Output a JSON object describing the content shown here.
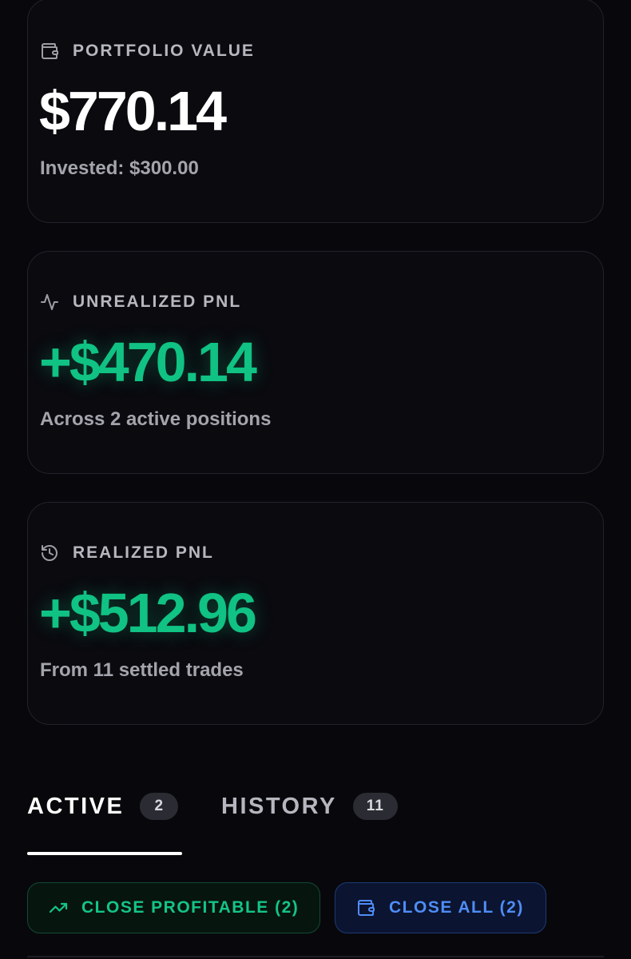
{
  "portfolio": {
    "label": "PORTFOLIO VALUE",
    "icon": "wallet-icon",
    "value": "$770.14",
    "subtext": "Invested: $300.00"
  },
  "unrealized": {
    "label": "UNREALIZED PNL",
    "icon": "activity-icon",
    "value": "+$470.14",
    "subtext": "Across 2 active positions",
    "value_color": "#10c283"
  },
  "realized": {
    "label": "REALIZED PNL",
    "icon": "history-icon",
    "value": "+$512.96",
    "subtext": "From 11 settled trades",
    "value_color": "#10c283"
  },
  "tabs": [
    {
      "label": "ACTIVE",
      "count": "2",
      "selected": true
    },
    {
      "label": "HISTORY",
      "count": "11",
      "selected": false
    }
  ],
  "actions": {
    "close_profitable": {
      "label": "CLOSE PROFITABLE (2)",
      "icon": "trending-up-icon",
      "color": "#14c585"
    },
    "close_all": {
      "label": "CLOSE ALL (2)",
      "icon": "wallet-icon",
      "color": "#4f8df7"
    }
  },
  "colors": {
    "background": "#08080c",
    "card_border": "#22232b",
    "label": "#b7b7bf",
    "positive": "#10c283"
  }
}
